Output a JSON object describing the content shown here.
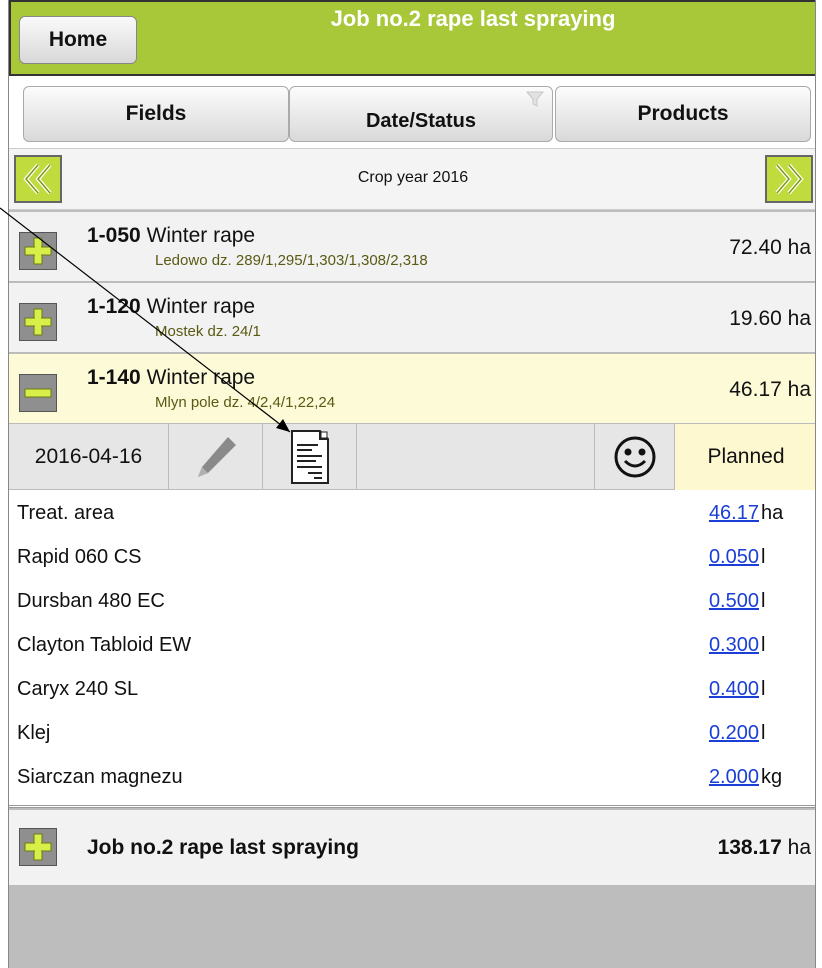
{
  "header": {
    "home_label": "Home",
    "title": "Job no.2 rape last spraying"
  },
  "tabs": {
    "fields": "Fields",
    "date_status": "Date/Status",
    "products": "Products"
  },
  "crop_bar": {
    "label": "Crop year 2016"
  },
  "fields": [
    {
      "code": "1-050",
      "crop": "Winter rape",
      "location": "Ledowo dz. 289/1,295/1,303/1,308/2,318",
      "area": "72.40 ha",
      "expanded": false
    },
    {
      "code": "1-120",
      "crop": "Winter rape",
      "location": "Mostek dz. 24/1",
      "area": "19.60 ha",
      "expanded": false
    },
    {
      "code": "1-140",
      "crop": "Winter rape",
      "location": "Mlyn pole dz. 4/2,4/1,22,24",
      "area": "46.17 ha",
      "expanded": true
    }
  ],
  "job": {
    "date": "2016-04-16",
    "status": "Planned"
  },
  "products": [
    {
      "name": "Treat. area",
      "value": "46.17",
      "unit": "ha"
    },
    {
      "name": "Rapid 060 CS",
      "value": "0.050",
      "unit": "l"
    },
    {
      "name": "Dursban 480 EC",
      "value": "0.500",
      "unit": "l"
    },
    {
      "name": "Clayton Tabloid EW",
      "value": "0.300",
      "unit": "l"
    },
    {
      "name": "Caryx 240 SL",
      "value": "0.400",
      "unit": "l"
    },
    {
      "name": "Klej",
      "value": "0.200",
      "unit": "l"
    },
    {
      "name": "Siarczan magnezu",
      "value": "2.000",
      "unit": "kg"
    }
  ],
  "summary": {
    "name": "Job no.2 rape last spraying",
    "area_value": "138.17",
    "area_unit": "ha"
  },
  "colors": {
    "header_green": "#a8c83a",
    "plus_yellow": "#d8ef4a",
    "link_blue": "#1a3fd6",
    "planned_bg": "#fdf8d0"
  },
  "icons": [
    "plus-icon",
    "minus-icon",
    "pencil-icon",
    "document-icon",
    "smiley-icon",
    "filter-icon",
    "double-chevron-left-icon",
    "double-chevron-right-icon"
  ]
}
